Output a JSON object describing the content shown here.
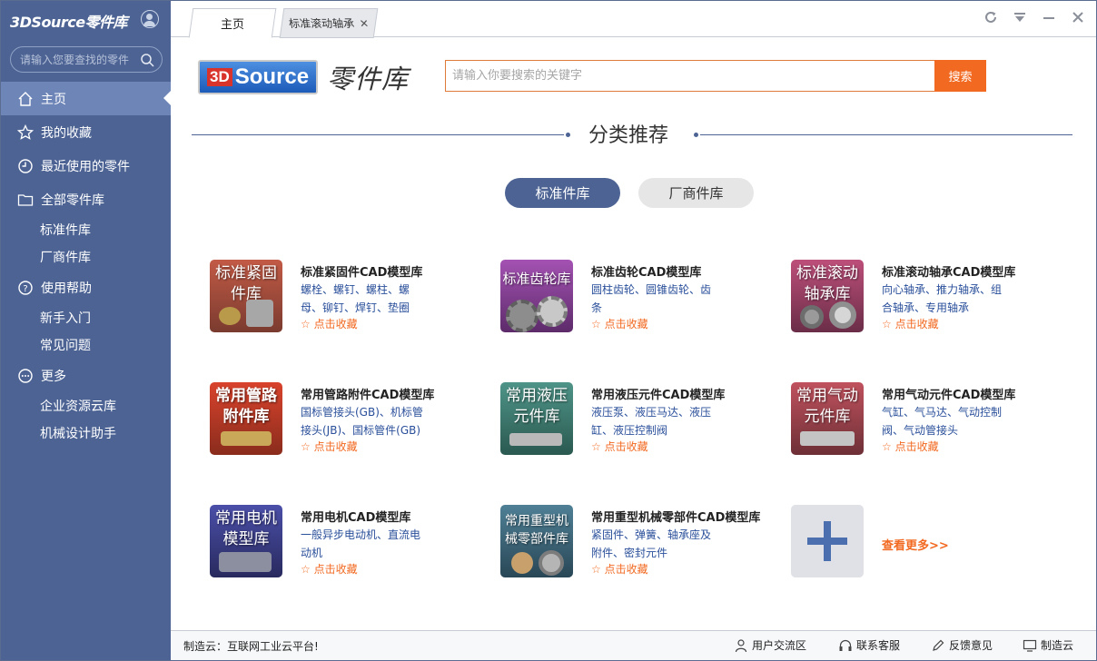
{
  "sidebar": {
    "brand": "3DSource零件库",
    "search_placeholder": "请输入您要查找的零件",
    "nav": {
      "home": "主页",
      "favorites": "我的收藏",
      "recent": "最近使用的零件",
      "all_parts": "全部零件库",
      "standard": "标准件库",
      "vendor": "厂商件库",
      "help": "使用帮助",
      "beginner": "新手入门",
      "faq": "常见问题",
      "more": "更多",
      "enterprise": "企业资源云库",
      "assistant": "机械设计助手"
    }
  },
  "tabs": {
    "home": "主页",
    "bearing": "标准滚动轴承",
    "close": "✕"
  },
  "header": {
    "logo_3d": "3D",
    "logo_source": "Source",
    "logo_text": "零件库",
    "search_placeholder": "请输入你要搜索的关键字",
    "search_button": "搜索"
  },
  "section": {
    "title": "分类推荐",
    "toggle_standard": "标准件库",
    "toggle_vendor": "厂商件库"
  },
  "cards": [
    {
      "thumb": "标准紧固\n件库",
      "title": "标准紧固件CAD模型库",
      "desc": "螺栓、螺钉、螺柱、螺母、铆钉、焊钉、垫圈",
      "fav": "☆ 点击收藏"
    },
    {
      "thumb": "标准齿轮库",
      "title": "标准齿轮CAD模型库",
      "desc": "圆柱齿轮、圆锥齿轮、齿条",
      "fav": "☆ 点击收藏"
    },
    {
      "thumb": "标准滚动\n轴承库",
      "title": "标准滚动轴承CAD模型库",
      "desc": "向心轴承、推力轴承、组合轴承、专用轴承",
      "fav": "☆ 点击收藏"
    },
    {
      "thumb": "常用管路\n附件库",
      "title": "常用管路附件CAD模型库",
      "desc": "国标管接头(GB)、机标管接头(JB)、国标管件(GB)",
      "fav": "☆ 点击收藏"
    },
    {
      "thumb": "常用液压\n元件库",
      "title": "常用液压元件CAD模型库",
      "desc": "液压泵、液压马达、液压缸、液压控制阀",
      "fav": "☆ 点击收藏"
    },
    {
      "thumb": "常用气动\n元件库",
      "title": "常用气动元件CAD模型库",
      "desc": "气缸、气马达、气动控制阀、气动管接头",
      "fav": "☆ 点击收藏"
    },
    {
      "thumb": "常用电机\n模型库",
      "title": "常用电机CAD模型库",
      "desc": "一般异步电动机、直流电动机",
      "fav": "☆ 点击收藏"
    },
    {
      "thumb": "常用重型机\n械零部件库",
      "title": "常用重型机械零部件CAD模型库",
      "desc": "紧固件、弹簧、轴承座及附件、密封元件",
      "fav": "☆ 点击收藏"
    }
  ],
  "more_link": "查看更多>>",
  "colors": {
    "sidebar_bg": "#4c6394",
    "sidebar_active": "#6e85b7",
    "accent_orange": "#f26a22",
    "link_blue": "#2a4f9a"
  },
  "status": {
    "left": "制造云：互联网工业云平台!",
    "community": "用户交流区",
    "service": "联系客服",
    "feedback": "反馈意见",
    "cloud": "制造云"
  }
}
